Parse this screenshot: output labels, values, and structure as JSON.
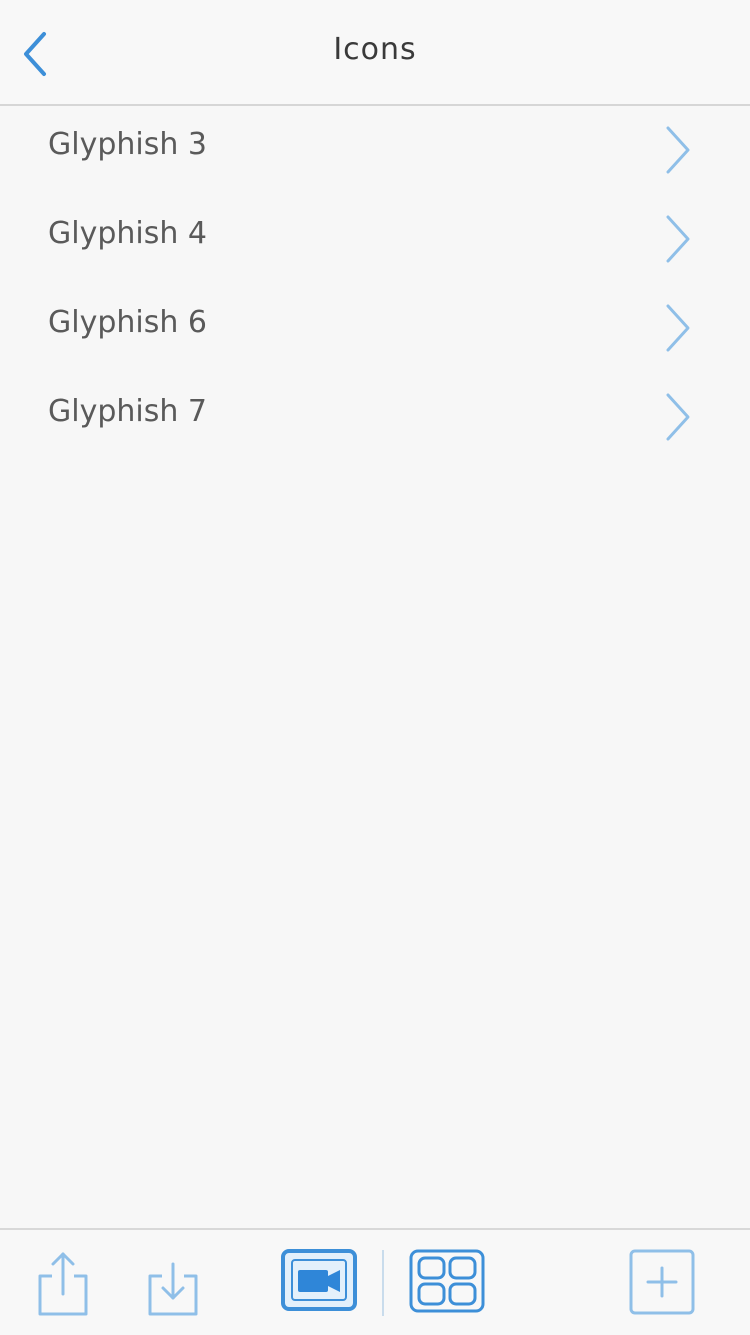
{
  "nav": {
    "title": "Icons",
    "back_icon": "chevron-left-icon"
  },
  "list": {
    "items": [
      {
        "label": "Glyphish 3"
      },
      {
        "label": "Glyphish 4"
      },
      {
        "label": "Glyphish 6"
      },
      {
        "label": "Glyphish 7"
      }
    ]
  },
  "toolbar": {
    "buttons": [
      {
        "icon": "share-icon"
      },
      {
        "icon": "download-icon"
      },
      {
        "icon": "video-view-icon",
        "selected": true
      },
      {
        "icon": "grid-view-icon"
      },
      {
        "icon": "add-icon"
      }
    ]
  },
  "colors": {
    "accent": "#3d8fd8",
    "accent_light": "#8fbfe8",
    "text": "#5a5a5a",
    "title": "#3a3a3a",
    "background": "#f7f7f7"
  }
}
